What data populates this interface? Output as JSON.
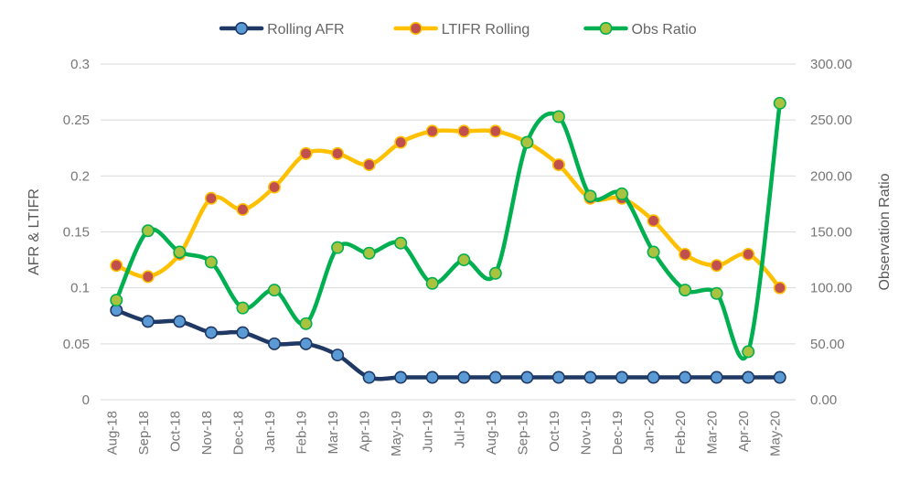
{
  "chart_data": {
    "type": "line",
    "title": "",
    "xlabel": "",
    "ylabel": "AFR & LTIFR",
    "y2label": "Observation Ratio",
    "ylim": [
      0,
      0.3
    ],
    "y2lim": [
      0,
      300
    ],
    "yticks": [
      "0",
      "0.05",
      "0.1",
      "0.15",
      "0.2",
      "0.25",
      "0.3"
    ],
    "ytick_values": [
      0,
      0.05,
      0.1,
      0.15,
      0.2,
      0.25,
      0.3
    ],
    "y2ticks": [
      "0.00",
      "50.00",
      "100.00",
      "150.00",
      "200.00",
      "250.00",
      "300.00"
    ],
    "y2tick_values": [
      0,
      50,
      100,
      150,
      200,
      250,
      300
    ],
    "grid": true,
    "legend_position": "top",
    "categories": [
      "Aug-18",
      "Sep-18",
      "Oct-18",
      "Nov-18",
      "Dec-18",
      "Jan-19",
      "Feb-19",
      "Mar-19",
      "Apr-19",
      "May-19",
      "Jun-19",
      "Jul-19",
      "Aug-19",
      "Sep-19",
      "Oct-19",
      "Nov-19",
      "Dec-19",
      "Jan-20",
      "Feb-20",
      "Mar-20",
      "Apr-20",
      "May-20"
    ],
    "series": [
      {
        "name": "Rolling AFR",
        "axis": "left",
        "color": "#1F3864",
        "marker_color": "#5B9BD5",
        "values": [
          0.08,
          0.07,
          0.07,
          0.06,
          0.06,
          0.05,
          0.05,
          0.04,
          0.02,
          0.02,
          0.02,
          0.02,
          0.02,
          0.02,
          0.02,
          0.02,
          0.02,
          0.02,
          0.02,
          0.02,
          0.02,
          0.02
        ]
      },
      {
        "name": "LTIFR Rolling",
        "axis": "left",
        "color": "#FFC000",
        "marker_color": "#C0504D",
        "values": [
          0.12,
          0.11,
          0.13,
          0.18,
          0.17,
          0.19,
          0.22,
          0.22,
          0.21,
          0.23,
          0.24,
          0.24,
          0.24,
          0.23,
          0.21,
          0.18,
          0.18,
          0.16,
          0.13,
          0.12,
          0.13,
          0.1
        ]
      },
      {
        "name": "Obs Ratio",
        "axis": "right",
        "color": "#00B050",
        "marker_color": "#A9C23F",
        "values": [
          89,
          151,
          132,
          123,
          82,
          98,
          68,
          136,
          131,
          140,
          104,
          125,
          113,
          230,
          253,
          182,
          184,
          132,
          98,
          95,
          43,
          265
        ]
      }
    ]
  }
}
